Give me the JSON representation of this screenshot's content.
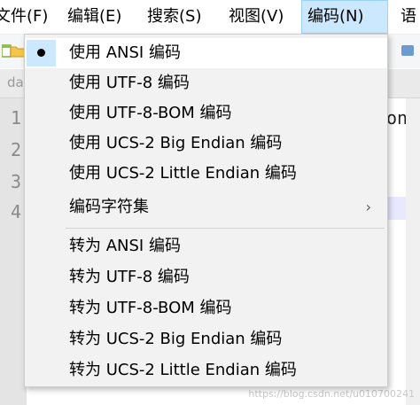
{
  "menubar": {
    "items": [
      {
        "label": "文件(F)"
      },
      {
        "label": "编辑(E)"
      },
      {
        "label": "搜索(S)"
      },
      {
        "label": "视图(V)"
      },
      {
        "label": "编码(N)",
        "active": true
      },
      {
        "label": "语"
      }
    ]
  },
  "editor": {
    "tab_label": "da",
    "line_numbers": [
      "1",
      "2",
      "3",
      "4"
    ],
    "line1_tail": "on"
  },
  "encoding_menu": {
    "selected_index": 0,
    "use_items": [
      {
        "label": "使用 ANSI 编码"
      },
      {
        "label": "使用 UTF-8 编码"
      },
      {
        "label": "使用 UTF-8-BOM 编码"
      },
      {
        "label": "使用 UCS-2 Big Endian 编码"
      },
      {
        "label": "使用 UCS-2 Little Endian 编码"
      }
    ],
    "charset_submenu": {
      "label": "编码字符集",
      "arrow": "›"
    },
    "convert_items": [
      {
        "label": "转为 ANSI 编码"
      },
      {
        "label": "转为 UTF-8 编码"
      },
      {
        "label": "转为 UTF-8-BOM 编码"
      },
      {
        "label": "转为 UCS-2 Big Endian 编码"
      },
      {
        "label": "转为 UCS-2 Little Endian 编码"
      }
    ]
  },
  "watermark": "https://blog.csdn.net/u010700241",
  "colors": {
    "menu_active_bg": "#cce8ff",
    "menu_bg": "#f2f2f2",
    "hover_bg": "#ffffff"
  }
}
